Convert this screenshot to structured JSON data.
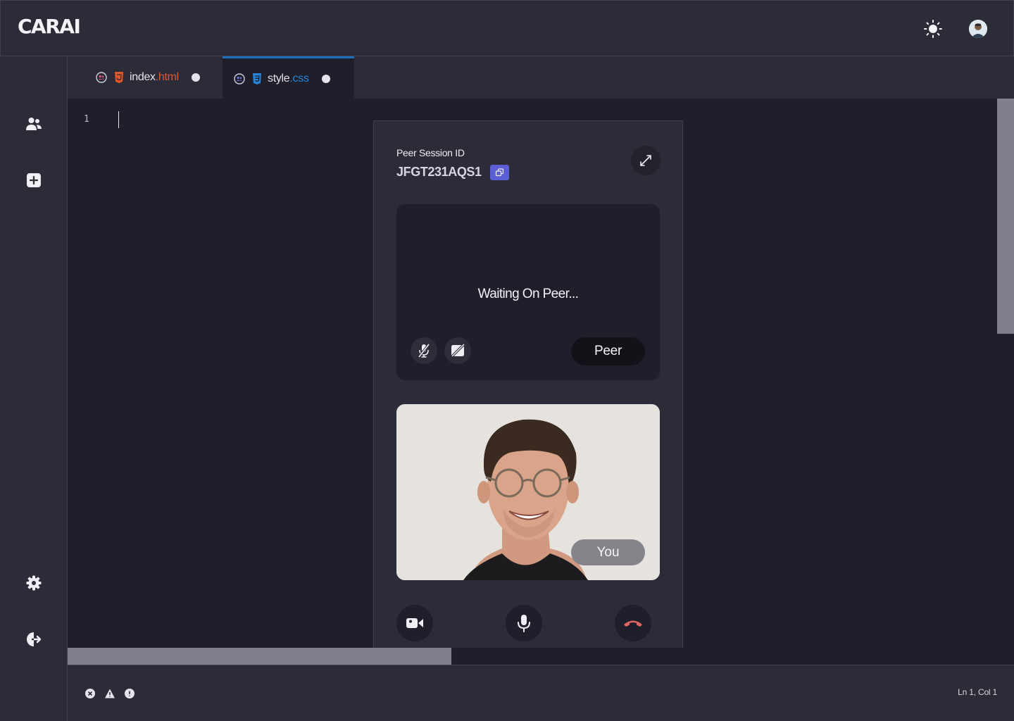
{
  "app": {
    "logo": "CARAI"
  },
  "header": {
    "theme_icon": "sun-icon",
    "avatar_icon": "user-avatar"
  },
  "sidebar": {
    "items": [
      {
        "icon": "users-icon"
      },
      {
        "icon": "plus-square-icon"
      },
      {
        "icon": "gear-icon"
      },
      {
        "icon": "logout-icon"
      }
    ]
  },
  "tabs": [
    {
      "name": "index",
      "ext": ".html",
      "active": false,
      "icon": "html5-icon"
    },
    {
      "name": "style",
      "ext": ".css",
      "active": true,
      "icon": "css3-icon"
    }
  ],
  "editor": {
    "line_numbers": [
      "1"
    ]
  },
  "session": {
    "label": "Peer Session ID",
    "id": "JFGT231AQS1",
    "copy_icon": "copy-icon",
    "swap_icon": "swap-arrows-icon"
  },
  "peer_view": {
    "status": "Waiting On Peer...",
    "tag": "Peer",
    "mic_icon": "mic-off-icon",
    "cam_icon": "camera-off-icon"
  },
  "self_view": {
    "tag": "You"
  },
  "call_controls": [
    {
      "icon": "video-camera-icon"
    },
    {
      "icon": "microphone-icon"
    },
    {
      "icon": "hang-up-icon"
    }
  ],
  "status_bar": {
    "icons": [
      "error-icon",
      "warning-icon",
      "info-icon"
    ],
    "position": "Ln 1,  Col 1"
  },
  "colors": {
    "accent": "#1c6fb8",
    "copy_button": "#5c5fd4",
    "hang_up": "#e06666",
    "html_ext": "#e0572a",
    "css_ext": "#2a83d4"
  }
}
